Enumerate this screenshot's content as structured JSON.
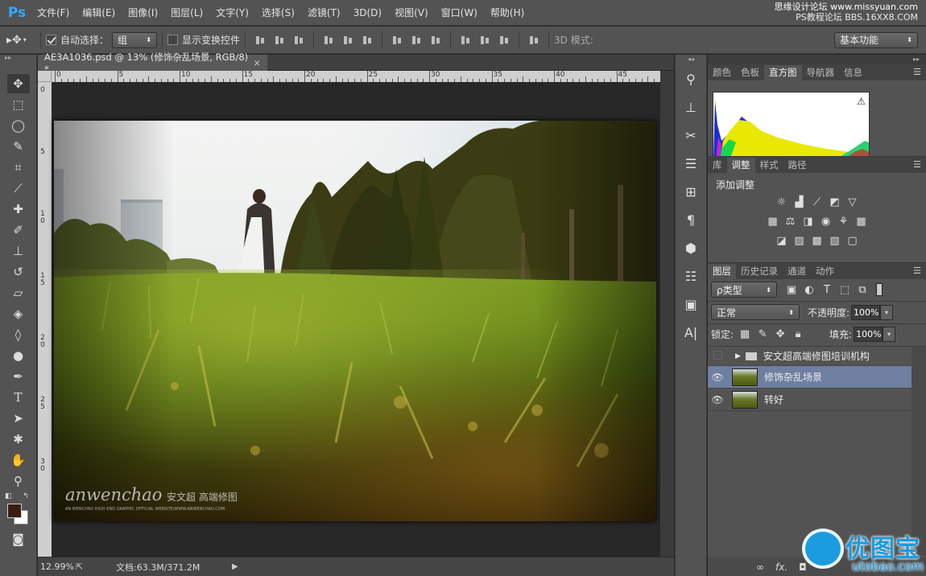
{
  "app": {
    "logo": "Ps",
    "menu": [
      "文件(F)",
      "编辑(E)",
      "图像(I)",
      "图层(L)",
      "文字(Y)",
      "选择(S)",
      "滤镜(T)",
      "3D(D)",
      "视图(V)",
      "窗口(W)",
      "帮助(H)"
    ],
    "watermark_line1": "思缘设计论坛 www.missyuan.com",
    "watermark_line2": "PS教程论坛 BBS.16XX8.COM"
  },
  "options": {
    "auto_select_label": "自动选择：",
    "auto_select_value": "组",
    "show_transform_label": "显示变换控件",
    "mode_3d_label": "3D 模式:",
    "workspace_value": "基本功能"
  },
  "document": {
    "tab_title": "AE3A1036.psd @ 13% (修饰杂乱场景, RGB/8) *",
    "tab_close": "×",
    "ruler_top": [
      "0",
      "5",
      "10",
      "15",
      "20",
      "25",
      "30",
      "35",
      "40",
      "45"
    ],
    "ruler_left": [
      "0",
      "5",
      "1\n0",
      "1\n5",
      "2\n0",
      "2\n5",
      "3\n0"
    ],
    "zoom": "12.99%",
    "doc_size": "文档:63.3M/371.2M",
    "photo_watermark_script": "anwenchao",
    "photo_watermark_cn": "安文超 高端修图",
    "photo_watermark_small": "AN WENCHAO HIGH-END GRAPHIC OFFICIAL WEBSITE/WWW.ANWENCHAO.COM"
  },
  "panels": {
    "top_tabs": [
      "颜色",
      "色板",
      "直方图",
      "导航器",
      "信息"
    ],
    "top_active": 2,
    "adj_tabs": [
      "库",
      "调整",
      "样式",
      "路径"
    ],
    "adj_active": 1,
    "adj_title": "添加调整",
    "layers_tabs": [
      "图层",
      "历史记录",
      "通道",
      "动作"
    ],
    "layers_active": 0,
    "filter_kind": "ρ类型",
    "blend_mode": "正常",
    "opacity_label": "不透明度:",
    "opacity_value": "100%",
    "lock_label": "锁定:",
    "fill_label": "填充:",
    "fill_value": "100%",
    "layers": [
      {
        "name": "安文超高端修图培训机构",
        "type": "group",
        "visible": false,
        "selected": false
      },
      {
        "name": "修饰杂乱场景",
        "type": "layer",
        "visible": true,
        "selected": true
      },
      {
        "name": "转好",
        "type": "layer",
        "visible": true,
        "selected": false
      }
    ],
    "footer_fx": "fx."
  },
  "site_logo": {
    "name": "优图宝",
    "url": "utobao.com"
  },
  "colors": {
    "ps_blue": "#31a8ff",
    "selected_layer": "#6e7fa1",
    "logo_blue": "#1b9be0"
  }
}
